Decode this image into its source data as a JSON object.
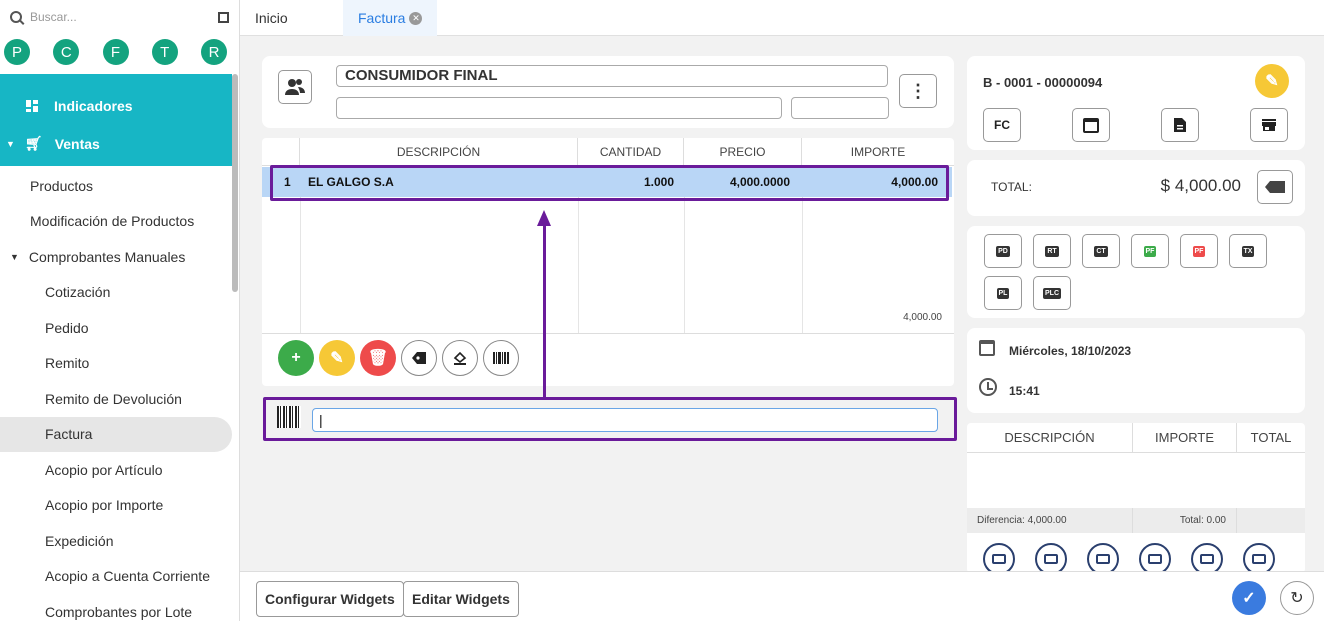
{
  "search": {
    "placeholder": "Buscar..."
  },
  "quick_circles": [
    "P",
    "C",
    "F",
    "T",
    "R"
  ],
  "sidebar": {
    "indicadores": "Indicadores",
    "ventas": "Ventas",
    "items": [
      "Productos",
      "Modificación de Productos",
      "Comprobantes Manuales",
      "Cotización",
      "Pedido",
      "Remito",
      "Remito de Devolución",
      "Factura",
      "Acopio por Artículo",
      "Acopio por Importe",
      "Expedición",
      "Acopio a Cuenta Corriente",
      "Comprobantes por Lote"
    ]
  },
  "tabs": {
    "inicio": "Inicio",
    "factura": "Factura"
  },
  "client": {
    "name": "CONSUMIDOR FINAL",
    "field2": "",
    "field3": ""
  },
  "items_table": {
    "headers": [
      "DESCRIPCIÓN",
      "CANTIDAD",
      "PRECIO",
      "IMPORTE"
    ],
    "row": {
      "index": "1",
      "description": "EL GALGO S.A",
      "quantity": "1.000",
      "price": "4,000.0000",
      "amount": "4,000.00"
    },
    "subtotal": "4,000.00"
  },
  "barcode": {
    "value": ""
  },
  "document": {
    "number": "B - 0001 - 00000094",
    "type": "FC"
  },
  "total": {
    "label": "TOTAL:",
    "amount": "$ 4,000.00"
  },
  "print_buttons": [
    "PD",
    "RT",
    "CT",
    "PF",
    "PF",
    "TX",
    "PL",
    "PLC"
  ],
  "date": {
    "date": "Miércoles, 18/10/2023",
    "time": "15:41"
  },
  "payments": {
    "headers": [
      "DESCRIPCIÓN",
      "IMPORTE",
      "TOTAL"
    ],
    "diferencia": "Diferencia: 4,000.00",
    "total": "Total: 0.00"
  },
  "bottom": {
    "configurar": "Configurar Widgets",
    "editar": "Editar Widgets"
  },
  "colors": {
    "accent": "#17b6c5",
    "highlight": "#6a1b9a",
    "row": "#b9d6f6",
    "circle": "#14a37f"
  }
}
